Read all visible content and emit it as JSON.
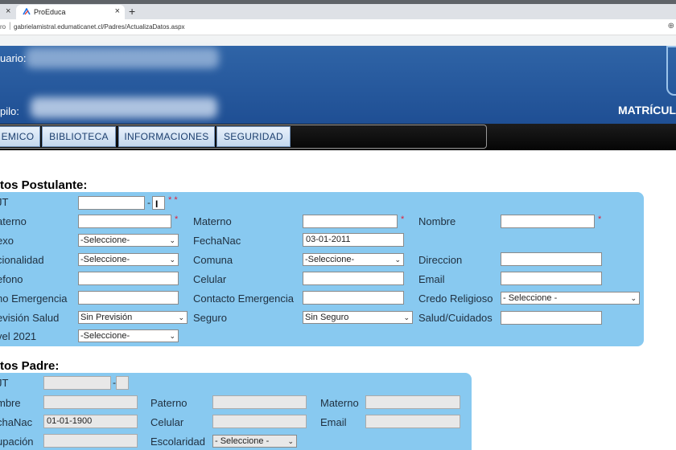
{
  "browser": {
    "tab_close_left": "×",
    "tab_title": "ProEduca",
    "tab_close": "×",
    "new_tab": "+",
    "url_scheme": "ro",
    "url": "gabrielamistral.edumaticanet.cl/Padres/ActualizaDatos.aspx",
    "zoom_icon": "⊕"
  },
  "header": {
    "usuario_label": "uario:",
    "pupilo_label": "pilo:",
    "matricula": "MATRÍCUL"
  },
  "nav": {
    "tabs": [
      "EMICO",
      "BIBLIOTECA",
      "INFORMACIONES",
      "SEGURIDAD"
    ]
  },
  "postulante": {
    "title": "tos Postulante:",
    "labels": {
      "rut": "JT",
      "paterno": "aterno",
      "materno": "Materno",
      "nombre": "Nombre",
      "sexo": "exo",
      "fechanac": "FechaNac",
      "nacionalidad": "cionalidad",
      "comuna": "Comuna",
      "direccion": "Direccion",
      "telefono": "efono",
      "celular": "Celular",
      "email": "Email",
      "fono_emergencia": "no Emergencia",
      "contacto_emergencia": "Contacto Emergencia",
      "credo": "Credo Religioso",
      "prevision": "evisión Salud",
      "seguro": "Seguro",
      "salud": "Salud/Cuidados",
      "nivel": "vel 2021"
    },
    "values": {
      "sexo": "-Seleccione-",
      "fechanac": "03-01-2011",
      "nacionalidad": "-Seleccione-",
      "comuna": "-Seleccione-",
      "credo": "- Seleccione -",
      "prevision": "Sin Previsión",
      "seguro": "Sin Seguro",
      "nivel": "-Seleccione-"
    },
    "required_double": "* *",
    "required": "*",
    "dash": "-",
    "cursor": "I"
  },
  "padre": {
    "title": "tos Padre:",
    "labels": {
      "rut": "JT",
      "nombre": "mbre",
      "paterno": "Paterno",
      "materno": "Materno",
      "fechanac": "chaNac",
      "celular": "Celular",
      "email": "Email",
      "ocupacion": "upación",
      "escolaridad": "Escolaridad"
    },
    "values": {
      "fechanac": "01-01-1900",
      "escolaridad": "- Seleccione -"
    },
    "dash": "-"
  },
  "icons": {
    "select_arrow": "⌄"
  }
}
